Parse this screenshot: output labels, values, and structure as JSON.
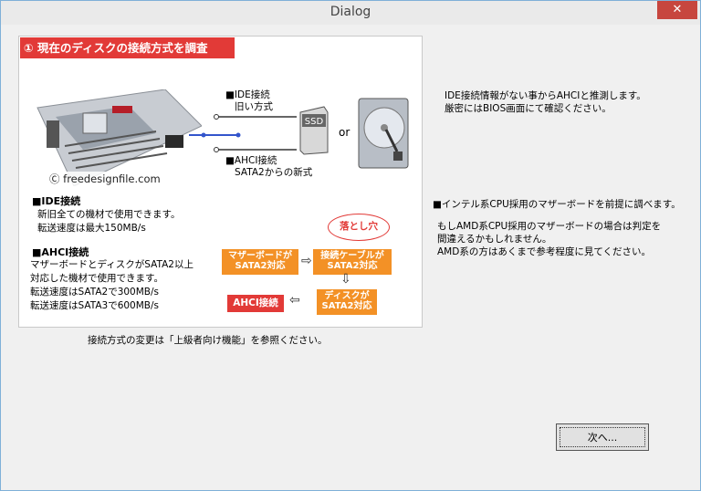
{
  "window": {
    "title": "Dialog",
    "close_glyph": "✕"
  },
  "panel": {
    "heading": "① 現在のディスクの接続方式を調査",
    "copyright": "Ⓒ freedesignfile.com",
    "ide_label": [
      "■IDE接続",
      "旧い方式"
    ],
    "ahci_label": [
      "■AHCI接続",
      "SATA2からの新式"
    ],
    "ssd_label": "SSD",
    "or_label": "or",
    "ide_section": {
      "title": "■IDE接続",
      "lines": [
        "新旧全ての機材で使用できます。",
        "転送速度は最大150MB/s"
      ]
    },
    "ahci_section": {
      "title": "■AHCI接続",
      "lines": [
        "マザーボードとディスクがSATA2以上",
        "対応した機材で使用できます。",
        "転送速度はSATA2で300MB/s",
        "転送速度はSATA3で600MB/s"
      ]
    },
    "flow": {
      "pitfall": "落とし穴",
      "motherboard": [
        "マザーボードが",
        "SATA2対応"
      ],
      "cable": [
        "接続ケーブルが",
        "SATA2対応"
      ],
      "disk": [
        "ディスクが",
        "SATA2対応"
      ],
      "result": "AHCI接続"
    }
  },
  "caption": "接続方式の変更は「上級者向け機能」を参照ください。",
  "side": {
    "note1": [
      "IDE接続情報がない事からAHCIと推測します。",
      "厳密にはBIOS画面にて確認ください。"
    ],
    "note2": "■インテル系CPU採用のマザーボードを前提に調べます。",
    "note3": [
      "もしAMD系CPU採用のマザーボードの場合は判定を",
      "間違えるかもしれません。",
      "AMD系の方はあくまで参考程度に見てください。"
    ]
  },
  "buttons": {
    "next": "次へ..."
  },
  "colors": {
    "red": "#e23a37",
    "orange": "#f39126",
    "border": "#7fb0d8"
  }
}
